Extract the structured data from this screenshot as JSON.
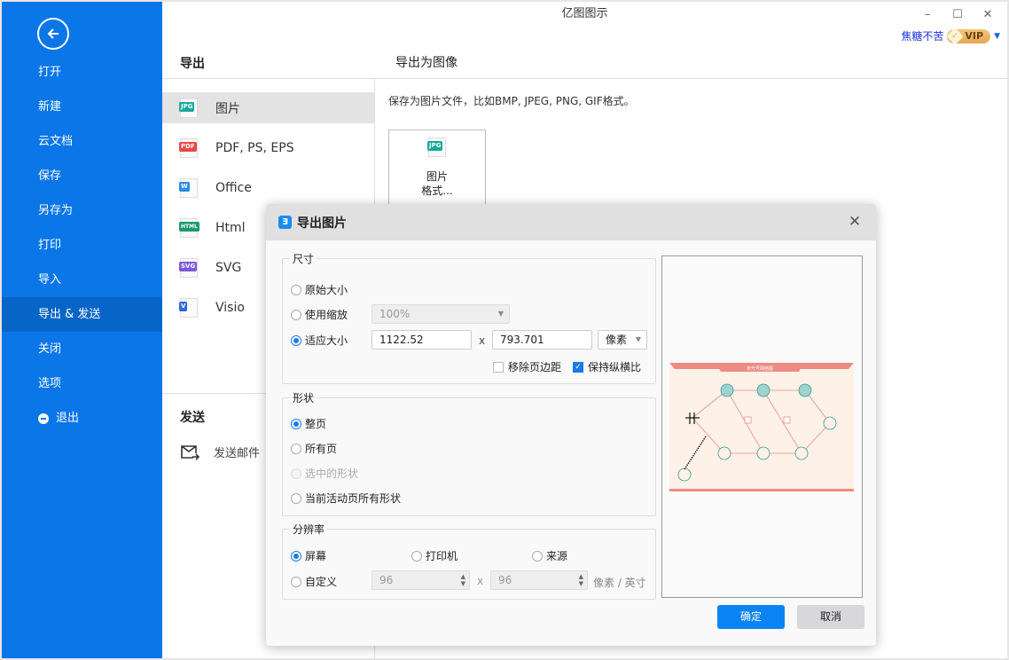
{
  "app": {
    "title": "亿图图示"
  },
  "window_controls": {
    "minimize": "–",
    "maximize": "☐",
    "close": "✕"
  },
  "user": {
    "name": "焦糖不苦",
    "vip_label": "VIP"
  },
  "sidebar": {
    "back_icon": "arrow-left-icon",
    "items": [
      {
        "label": "打开"
      },
      {
        "label": "新建"
      },
      {
        "label": "云文档"
      },
      {
        "label": "保存"
      },
      {
        "label": "另存为"
      },
      {
        "label": "打印"
      },
      {
        "label": "导入"
      },
      {
        "label": "导出 & 发送",
        "active": true
      },
      {
        "label": "关闭"
      },
      {
        "label": "选项"
      },
      {
        "label": "退出",
        "icon": "minus-circle-icon"
      }
    ]
  },
  "export": {
    "heading": "导出",
    "items": [
      {
        "label": "图片",
        "tag": "JPG",
        "color": "#1aa89a",
        "active": true
      },
      {
        "label": "PDF, PS, EPS",
        "tag": "PDF",
        "color": "#e84848"
      },
      {
        "label": "Office",
        "tag": "W",
        "color": "#2b8ae8"
      },
      {
        "label": "Html",
        "tag": "HTML",
        "color": "#1a9a6a"
      },
      {
        "label": "SVG",
        "tag": "SVG",
        "color": "#7a5ad8"
      },
      {
        "label": "Visio",
        "tag": "V",
        "color": "#2a6ad8"
      }
    ],
    "send_heading": "发送",
    "send_mail": "发送邮件"
  },
  "image_panel": {
    "heading": "导出为图像",
    "description": "保存为图片文件，比如BMP, JPEG, PNG, GIF格式。",
    "card_line1": "图片",
    "card_line2": "格式...",
    "card_tag": "JPG"
  },
  "dialog": {
    "title": "导出图片",
    "logo": "Ǝ",
    "close": "✕",
    "size": {
      "legend": "尺寸",
      "original": "原始大小",
      "use_zoom": "使用缩放",
      "zoom_value": "100%",
      "fit": "适应大小",
      "width": "1122.52",
      "x": "x",
      "height": "793.701",
      "unit": "像素",
      "remove_margin": "移除页边距",
      "remove_margin_checked": false,
      "keep_ratio": "保持纵横比",
      "keep_ratio_checked": true,
      "selected": "fit"
    },
    "shape": {
      "legend": "形状",
      "options": [
        "整页",
        "所有页",
        "选中的形状",
        "当前活动页所有形状"
      ],
      "selected": "整页",
      "disabled": [
        "选中的形状"
      ]
    },
    "resolution": {
      "legend": "分辨率",
      "screen": "屏幕",
      "printer": "打印机",
      "source": "来源",
      "custom": "自定义",
      "dpi_x": "96",
      "x": "x",
      "dpi_y": "96",
      "unit": "像素 / 英寸",
      "selected": "屏幕"
    },
    "preview": {
      "diagram_title": "单代号网络图"
    },
    "ok": "确定",
    "cancel": "取消"
  }
}
